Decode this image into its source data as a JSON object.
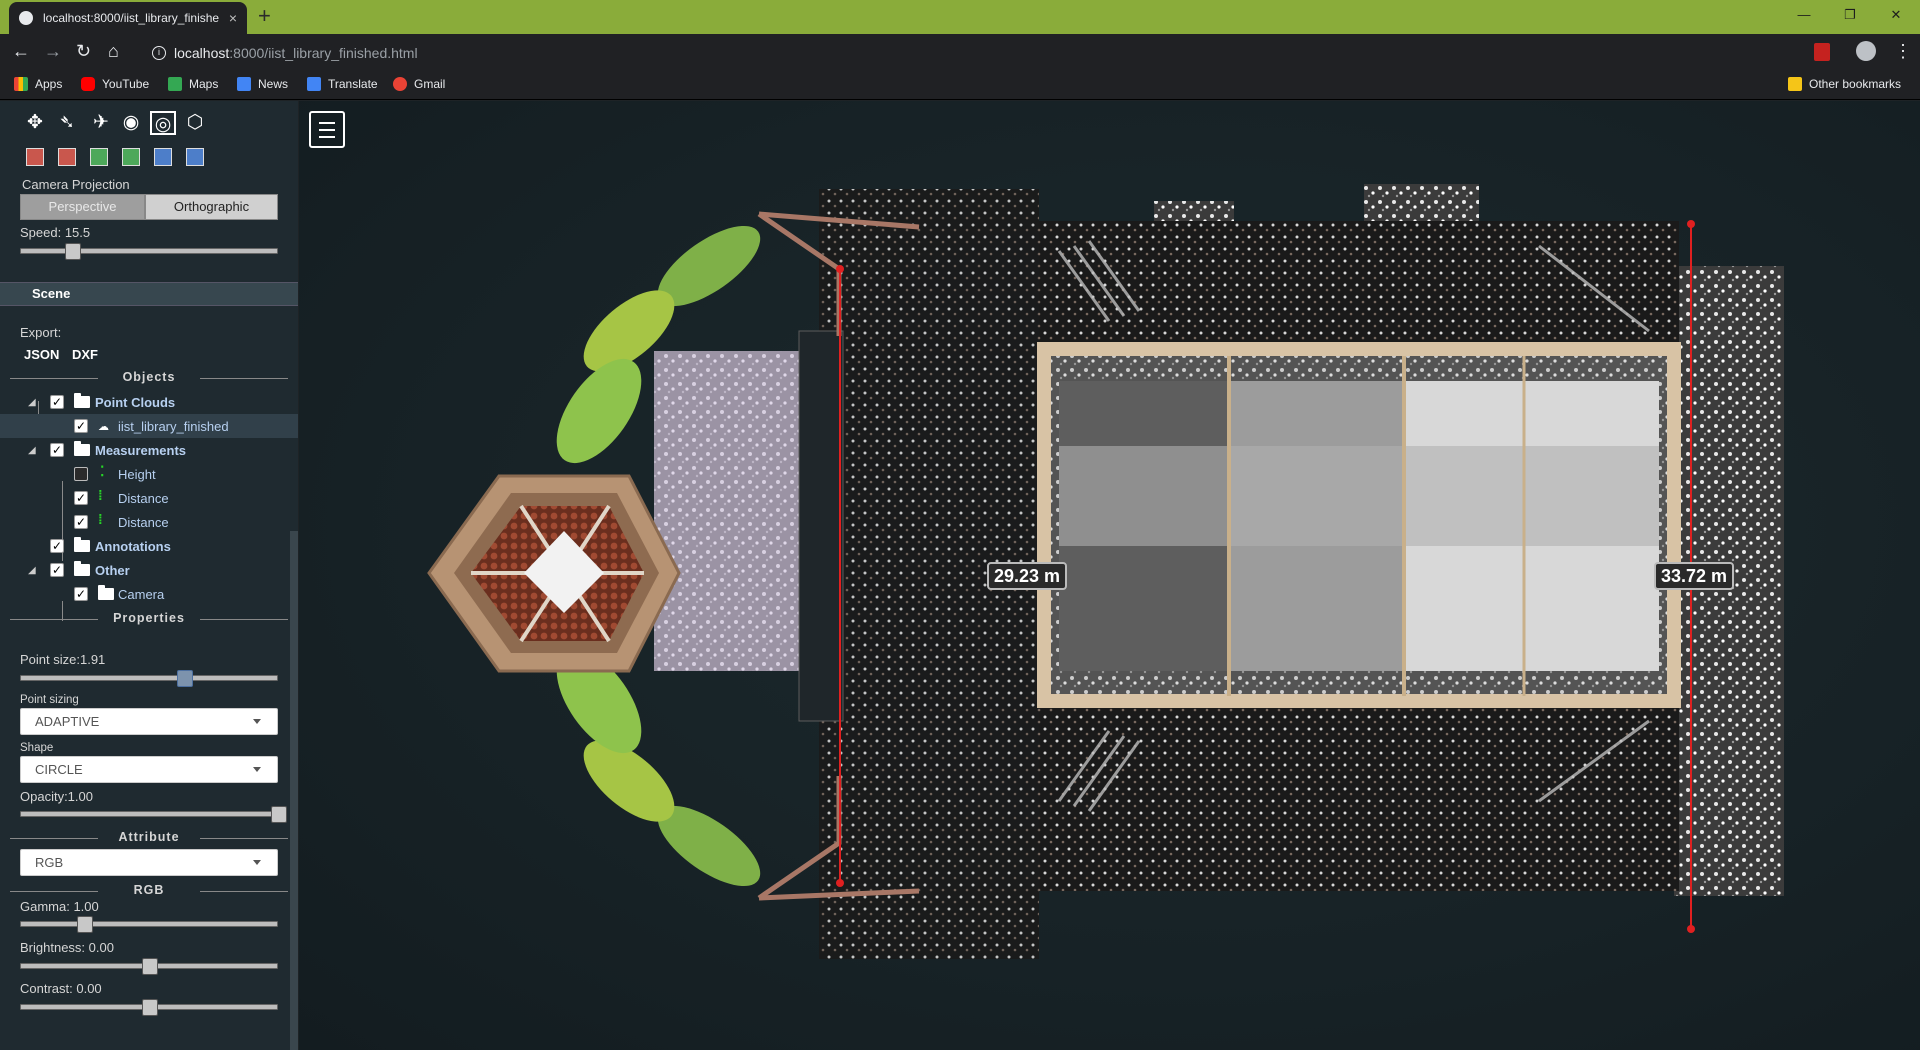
{
  "browser": {
    "tab_title": "localhost:8000/iist_library_finishe",
    "tab_close": "×",
    "new_tab": "+",
    "url_host": "localhost",
    "url_path": ":8000/iist_library_finished.html",
    "window_controls": [
      "—",
      "❐",
      "✕"
    ],
    "bookmarks": [
      {
        "label": "Apps",
        "icon": "apps-grid-icon",
        "color": "#e8eaed"
      },
      {
        "label": "YouTube",
        "icon": "youtube-icon",
        "color": "#ff0000"
      },
      {
        "label": "Maps",
        "icon": "maps-icon",
        "color": "#34a853"
      },
      {
        "label": "News",
        "icon": "news-icon",
        "color": "#4285f4"
      },
      {
        "label": "Translate",
        "icon": "translate-icon",
        "color": "#4285f4"
      },
      {
        "label": "Gmail",
        "icon": "google-icon",
        "color": "#ea4335"
      }
    ],
    "other_bookmarks": "Other bookmarks"
  },
  "panel": {
    "nav_tools": [
      "earth-controls-icon",
      "fly-controls-icon",
      "helicopter-controls-icon",
      "orbit-controls-icon",
      "focus-icon",
      "navigation-cube-icon"
    ],
    "view_cubes": [
      {
        "name": "left-view-icon",
        "color": "#c9574d"
      },
      {
        "name": "right-view-icon",
        "color": "#c9574d"
      },
      {
        "name": "front-view-icon",
        "color": "#4da85a"
      },
      {
        "name": "back-view-icon",
        "color": "#4da85a"
      },
      {
        "name": "top-view-icon",
        "color": "#4d7ec9"
      },
      {
        "name": "bottom-view-icon",
        "color": "#4d7ec9"
      }
    ],
    "camera_projection_label": "Camera Projection",
    "perspective_label": "Perspective",
    "orthographic_label": "Orthographic",
    "speed_label": "Speed: 15.5",
    "scene_label": "Scene",
    "export_label": "Export:",
    "export_json": "JSON",
    "export_dxf": "DXF",
    "objects_label": "Objects",
    "tree": {
      "point_clouds": "Point Clouds",
      "iist_library": "iist_library_finished",
      "measurements": "Measurements",
      "height": "Height",
      "distance1": "Distance",
      "distance2": "Distance",
      "annotations": "Annotations",
      "other": "Other",
      "camera": "Camera"
    },
    "properties_label": "Properties",
    "point_size_label": "Point size:1.91",
    "point_sizing_label": "Point sizing",
    "point_sizing_value": "ADAPTIVE",
    "shape_label": "Shape",
    "shape_value": "CIRCLE",
    "opacity_label": "Opacity:1.00",
    "attribute_label": "Attribute",
    "attribute_value": "RGB",
    "rgb_label": "RGB",
    "gamma_label": "Gamma: 1.00",
    "brightness_label": "Brightness: 0.00",
    "contrast_label": "Contrast: 0.00"
  },
  "viewport": {
    "measure_left": "29.23 m",
    "measure_right": "33.72 m"
  }
}
